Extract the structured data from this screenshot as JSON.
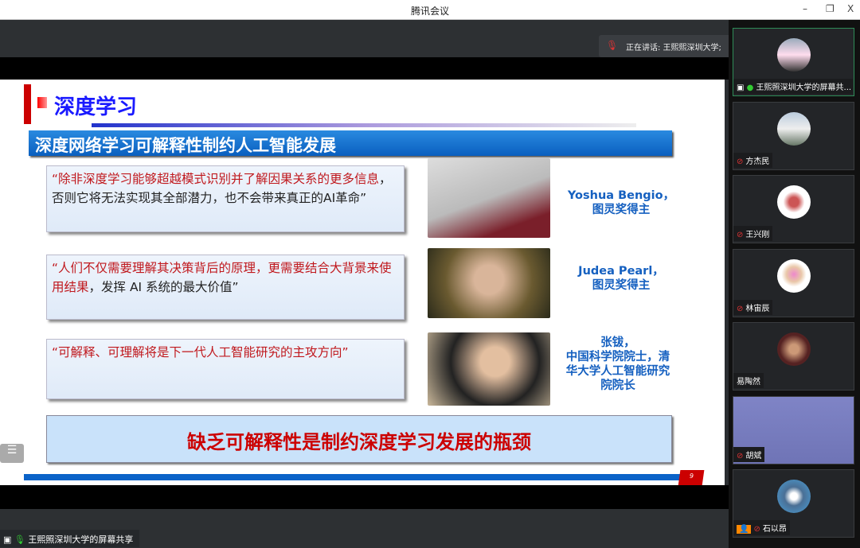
{
  "window": {
    "title": "腾讯会议",
    "minimize": "–",
    "restore": "❐",
    "close": "X"
  },
  "speaking": {
    "label": "正在讲话: 王熙熙深圳大学;"
  },
  "share_label": "王熙照深圳大学的屏幕共享",
  "slide": {
    "title": "深度学习",
    "subtitle": "深度网络学习可解释性制约人工智能发展",
    "quotes": [
      {
        "red": "“除非深度学习能够超越模式识别并了解因果关系的更多信息",
        "black": "，否则它将无法实现其全部潜力，也不会带来真正的AI革命”",
        "caption_l1": "Yoshua Bengio，",
        "caption_l2": "图灵奖得主"
      },
      {
        "red": "“人们不仅需要理解其决策背后的原理，更需要结合大背景来使用结果",
        "black": "，发挥 AI 系统的最大价值”",
        "caption_l1": "Judea Pearl，",
        "caption_l2": "图灵奖得主"
      },
      {
        "red": "“可解释、可理解将是下一代人工智能研究的主攻方向”",
        "black": "",
        "caption_l1": "张钹，",
        "caption_l2": "中国科学院院士，清华大学人工智能研究院院长"
      }
    ],
    "conclusion": "缺乏可解释性是制约深度学习发展的瓶颈",
    "page": "9"
  },
  "participants": [
    {
      "name": "王熙照深圳大学的屏幕共...",
      "active": true
    },
    {
      "name": "方杰民"
    },
    {
      "name": "王兴刚"
    },
    {
      "name": "林宙辰"
    },
    {
      "name": "易陶然"
    },
    {
      "name": "胡斌"
    },
    {
      "name": "石以昂"
    }
  ],
  "colors": {
    "accent_blue": "#0b63c8",
    "accent_red": "#c00000",
    "title_blue": "#1a1aff"
  }
}
